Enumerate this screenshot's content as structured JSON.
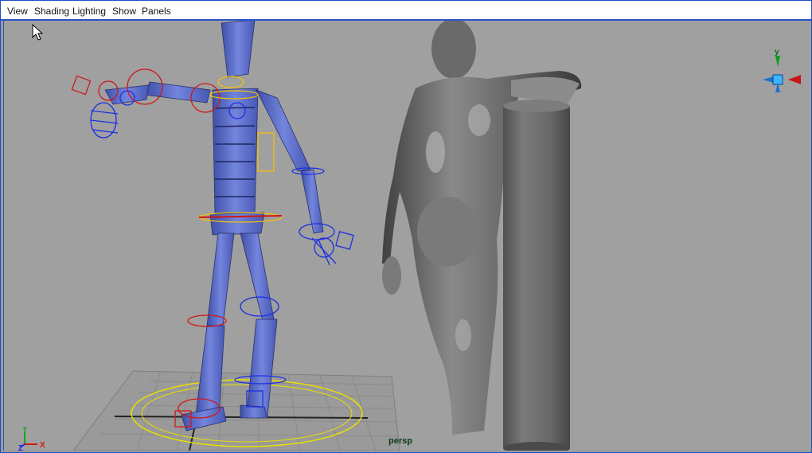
{
  "menubar": {
    "items": [
      {
        "label": "View"
      },
      {
        "label": "Shading"
      },
      {
        "label": "Lighting"
      },
      {
        "label": "Show"
      },
      {
        "label": "Panels"
      }
    ]
  },
  "viewport": {
    "camera_label": "persp",
    "background_color": "#a0a0a0"
  },
  "axis_indicator": {
    "y": "Y",
    "z": "Z",
    "x": "X"
  },
  "view_cube": {
    "y_label": "y"
  },
  "colors": {
    "joint_blue": "#1c2fe0",
    "ik_red": "#d11818",
    "selection_yellow": "#f2c200",
    "rig_body": "#6a7bd0",
    "sculpt_gray": "#7c7c7c"
  }
}
